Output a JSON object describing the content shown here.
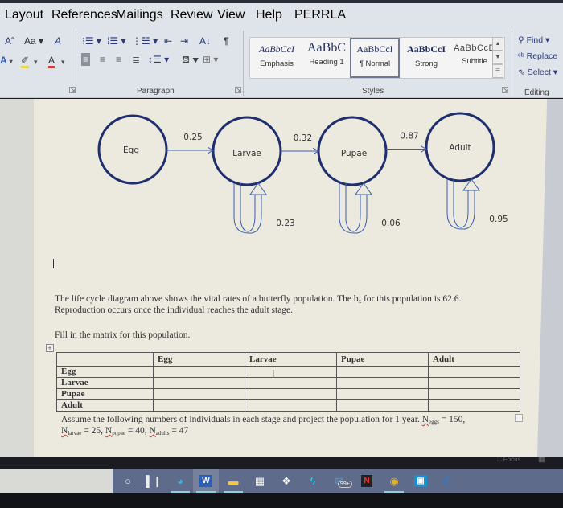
{
  "ribbon": {
    "tabs": [
      "Layout",
      "References",
      "Mailings",
      "Review",
      "View",
      "Help",
      "PERRLA"
    ],
    "font_group": {
      "grow_font": "Aˆ",
      "change_case": "Aa",
      "clear_format": "A",
      "text_effects": "A",
      "highlight": "✐",
      "font_color": "A",
      "highlight_color": "#e8d84a",
      "font_color_bar": "#d33a3a"
    },
    "paragraph_group": {
      "label": "Paragraph",
      "sort_icon": "A↓",
      "pilcrow": "¶"
    },
    "styles_group": {
      "label": "Styles",
      "items": [
        {
          "preview": "AaBbCcI",
          "name": "Emphasis"
        },
        {
          "preview": "AaBbC",
          "name": "Heading 1"
        },
        {
          "preview": "AaBbCcI",
          "name": "¶ Normal",
          "selected": true
        },
        {
          "preview": "AaBbCcI",
          "name": "Strong"
        },
        {
          "preview": "AaBbCcD",
          "name": "Subtitle"
        }
      ]
    },
    "editing_group": {
      "label": "Editing",
      "find": "Find",
      "replace": "Replace",
      "select": "Select"
    }
  },
  "diagram": {
    "stages": [
      "Egg",
      "Larvae",
      "Pupae",
      "Adult"
    ],
    "transitions": [
      {
        "from": "Egg",
        "to": "Larvae",
        "rate": "0.25"
      },
      {
        "from": "Larvae",
        "to": "Pupae",
        "rate": "0.32"
      },
      {
        "from": "Pupae",
        "to": "Adult",
        "rate": "0.87"
      }
    ],
    "self_loops": [
      {
        "stage": "Larvae",
        "rate": "0.23"
      },
      {
        "stage": "Pupae",
        "rate": "0.06"
      },
      {
        "stage": "Adult",
        "rate": "0.95"
      }
    ],
    "stroke_color": "#1f2f6e"
  },
  "document": {
    "para1_line1_a": "The life cycle diagram above shows the vital rates of a butterfly population.  The b",
    "para1_line1_sub": "x",
    "para1_line1_b": " for this population is 62.6.",
    "para1_line2": "Reproduction occurs once the individual reaches the adult stage.",
    "para2": "Fill in the matrix for this population.",
    "matrix": {
      "col_headers": [
        "",
        "Egg",
        "Larvae",
        "Pupae",
        "Adult"
      ],
      "row_headers": [
        "Egg",
        "Larvae",
        "Pupae",
        "Adult"
      ],
      "cells": [
        [
          "",
          "",
          "",
          ""
        ],
        [
          "",
          "",
          "",
          ""
        ],
        [
          "",
          "",
          "",
          ""
        ],
        [
          "",
          "",
          "",
          ""
        ]
      ]
    },
    "para3_line1": "Assume the following numbers of individuals in each stage and project the population for 1 year.  ",
    "n_eggs_label": "N",
    "n_eggs_sub": "eggs",
    "n_eggs_value": " = 150,",
    "n_larvae_label": "N",
    "n_larvae_sub": "larvae",
    "n_larvae_value": " = 25, ",
    "n_pupae_label": "N",
    "n_pupae_sub": "pupae",
    "n_pupae_value": " = 40, ",
    "n_adults_label": "N",
    "n_adults_sub": "adults",
    "n_adults_value": " = 47"
  },
  "status": {
    "focus": "Focus"
  },
  "taskbar": {
    "items": [
      {
        "name": "cortana",
        "glyph": "○"
      },
      {
        "name": "task-view",
        "glyph": "▌❙"
      },
      {
        "name": "edge",
        "glyph": "◕"
      },
      {
        "name": "word",
        "glyph": "W"
      },
      {
        "name": "file-explorer",
        "glyph": "▬"
      },
      {
        "name": "store",
        "glyph": "▦"
      },
      {
        "name": "dropbox",
        "glyph": "❖"
      },
      {
        "name": "app-bolt",
        "glyph": "ϟ"
      },
      {
        "name": "mail",
        "glyph": "✉",
        "badge": "99+"
      },
      {
        "name": "netflix",
        "glyph": "N"
      },
      {
        "name": "chrome",
        "glyph": "◉"
      },
      {
        "name": "app-tile",
        "glyph": "▣"
      },
      {
        "name": "app-p",
        "glyph": "ⓟ"
      }
    ]
  }
}
